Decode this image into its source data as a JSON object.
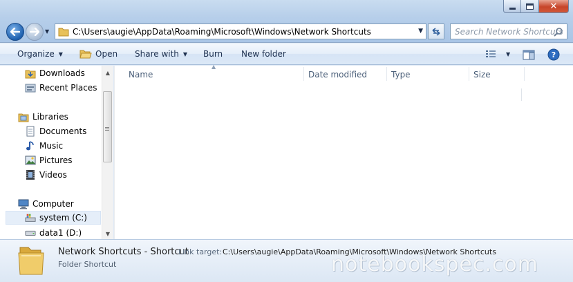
{
  "window": {
    "min_icon": "minimize-icon",
    "max_icon": "maximize-icon",
    "close_glyph": "✕"
  },
  "navigation": {
    "address": "C:\\Users\\augie\\AppData\\Roaming\\Microsoft\\Windows\\Network Shortcuts",
    "search_placeholder": "Search Network Shortcuts"
  },
  "toolbar": {
    "organize": "Organize",
    "open": "Open",
    "share_with": "Share with",
    "burn": "Burn",
    "new_folder": "New folder"
  },
  "sidebar": {
    "downloads": "Downloads",
    "recent_places": "Recent Places",
    "libraries": "Libraries",
    "documents": "Documents",
    "music": "Music",
    "pictures": "Pictures",
    "videos": "Videos",
    "computer": "Computer",
    "system_c": "system (C:)",
    "data1_d": "data1 (D:)"
  },
  "columns": {
    "name": "Name",
    "date_modified": "Date modified",
    "type": "Type",
    "size": "Size"
  },
  "details": {
    "name": "Network Shortcuts - Shortcut",
    "link_target_label": "Link target:",
    "link_target": "C:\\Users\\augie\\AppData\\Roaming\\Microsoft\\Windows\\Network Shortcuts",
    "type": "Folder Shortcut"
  },
  "watermark": "notebookspec.com",
  "colors": {
    "chrome": "#b7cfea",
    "close_button": "#c7452a",
    "selected_item": "#e5eef9"
  }
}
